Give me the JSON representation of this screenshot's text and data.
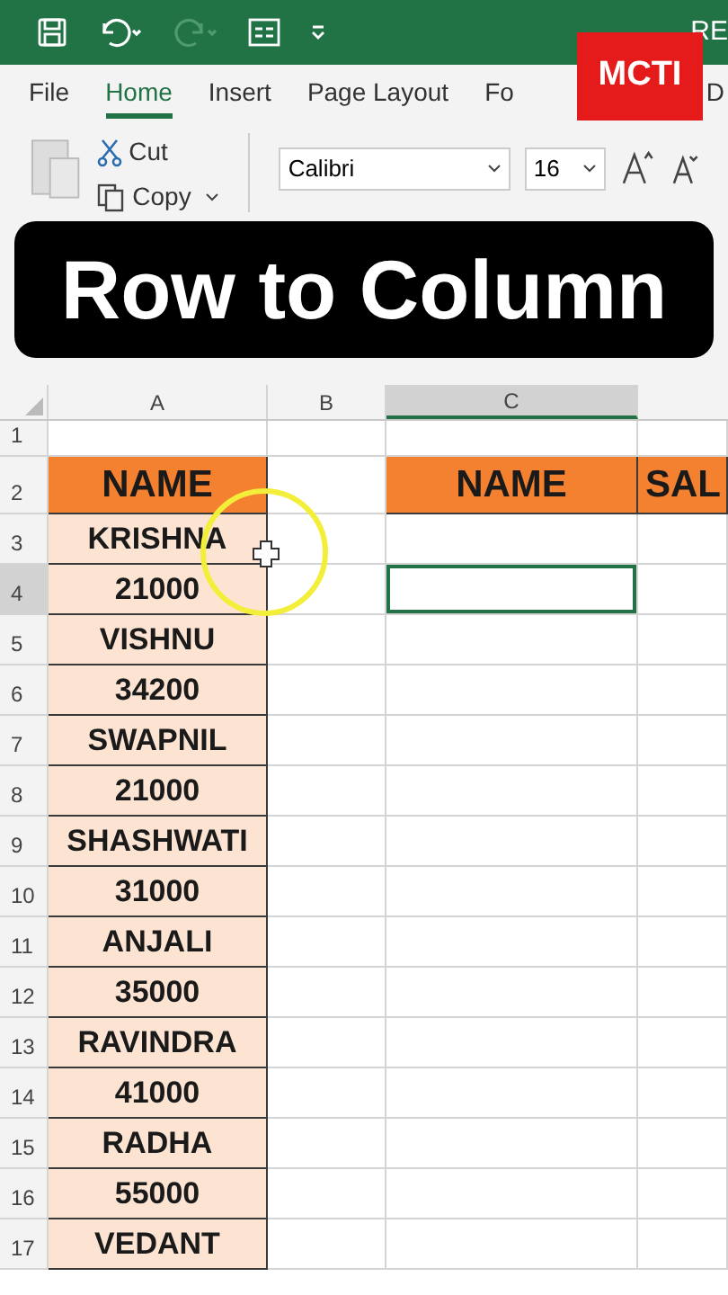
{
  "title_bar": {
    "title": "RE",
    "redo_disabled": true
  },
  "logo": {
    "text": "MCTI"
  },
  "tabs": [
    {
      "label": "File",
      "selected": false
    },
    {
      "label": "Home",
      "selected": true
    },
    {
      "label": "Insert",
      "selected": false
    },
    {
      "label": "Page Layout",
      "selected": false
    },
    {
      "label": "Fo",
      "selected": false
    },
    {
      "label": "D",
      "selected": false
    }
  ],
  "ribbon": {
    "cut": "Cut",
    "copy": "Copy",
    "font": "Calibri",
    "size": "16"
  },
  "caption": "Row to Column",
  "sheet": {
    "columns": [
      {
        "label": "A",
        "selected": false
      },
      {
        "label": "B",
        "selected": false
      },
      {
        "label": "C",
        "selected": true
      }
    ],
    "rows": [
      {
        "number": "1",
        "selected": false,
        "cells": [
          {
            "kind": "empty",
            "selected": false
          },
          {
            "kind": "empty",
            "selected": false
          },
          {
            "kind": "empty",
            "selected": false
          },
          {
            "kind": "empty",
            "selected": false
          }
        ]
      },
      {
        "number": "2",
        "selected": false,
        "cells": [
          {
            "kind": "header",
            "text": "NAME",
            "selected": false
          },
          {
            "kind": "empty",
            "selected": false
          },
          {
            "kind": "header",
            "text": "NAME",
            "selected": false
          },
          {
            "kind": "header",
            "text": "SAL",
            "selected": false
          }
        ]
      },
      {
        "number": "3",
        "selected": false,
        "cells": [
          {
            "kind": "data",
            "text": "KRISHNA",
            "selected": false
          },
          {
            "kind": "empty",
            "selected": false
          },
          {
            "kind": "empty",
            "selected": false
          },
          {
            "kind": "empty",
            "selected": false
          }
        ]
      },
      {
        "number": "4",
        "selected": true,
        "cells": [
          {
            "kind": "data",
            "text": "21000",
            "selected": false
          },
          {
            "kind": "empty",
            "selected": false
          },
          {
            "kind": "empty",
            "selected": true
          },
          {
            "kind": "empty",
            "selected": false
          }
        ]
      },
      {
        "number": "5",
        "selected": false,
        "cells": [
          {
            "kind": "data",
            "text": "VISHNU",
            "selected": false
          },
          {
            "kind": "empty",
            "selected": false
          },
          {
            "kind": "empty",
            "selected": false
          },
          {
            "kind": "empty",
            "selected": false
          }
        ]
      },
      {
        "number": "6",
        "selected": false,
        "cells": [
          {
            "kind": "data",
            "text": "34200",
            "selected": false
          },
          {
            "kind": "empty",
            "selected": false
          },
          {
            "kind": "empty",
            "selected": false
          },
          {
            "kind": "empty",
            "selected": false
          }
        ]
      },
      {
        "number": "7",
        "selected": false,
        "cells": [
          {
            "kind": "data",
            "text": "SWAPNIL",
            "selected": false
          },
          {
            "kind": "empty",
            "selected": false
          },
          {
            "kind": "empty",
            "selected": false
          },
          {
            "kind": "empty",
            "selected": false
          }
        ]
      },
      {
        "number": "8",
        "selected": false,
        "cells": [
          {
            "kind": "data",
            "text": "21000",
            "selected": false
          },
          {
            "kind": "empty",
            "selected": false
          },
          {
            "kind": "empty",
            "selected": false
          },
          {
            "kind": "empty",
            "selected": false
          }
        ]
      },
      {
        "number": "9",
        "selected": false,
        "cells": [
          {
            "kind": "data",
            "text": "SHASHWATI",
            "selected": false
          },
          {
            "kind": "empty",
            "selected": false
          },
          {
            "kind": "empty",
            "selected": false
          },
          {
            "kind": "empty",
            "selected": false
          }
        ]
      },
      {
        "number": "10",
        "selected": false,
        "cells": [
          {
            "kind": "data",
            "text": "31000",
            "selected": false
          },
          {
            "kind": "empty",
            "selected": false
          },
          {
            "kind": "empty",
            "selected": false
          },
          {
            "kind": "empty",
            "selected": false
          }
        ]
      },
      {
        "number": "11",
        "selected": false,
        "cells": [
          {
            "kind": "data",
            "text": "ANJALI",
            "selected": false
          },
          {
            "kind": "empty",
            "selected": false
          },
          {
            "kind": "empty",
            "selected": false
          },
          {
            "kind": "empty",
            "selected": false
          }
        ]
      },
      {
        "number": "12",
        "selected": false,
        "cells": [
          {
            "kind": "data",
            "text": "35000",
            "selected": false
          },
          {
            "kind": "empty",
            "selected": false
          },
          {
            "kind": "empty",
            "selected": false
          },
          {
            "kind": "empty",
            "selected": false
          }
        ]
      },
      {
        "number": "13",
        "selected": false,
        "cells": [
          {
            "kind": "data",
            "text": "RAVINDRA",
            "selected": false
          },
          {
            "kind": "empty",
            "selected": false
          },
          {
            "kind": "empty",
            "selected": false
          },
          {
            "kind": "empty",
            "selected": false
          }
        ]
      },
      {
        "number": "14",
        "selected": false,
        "cells": [
          {
            "kind": "data",
            "text": "41000",
            "selected": false
          },
          {
            "kind": "empty",
            "selected": false
          },
          {
            "kind": "empty",
            "selected": false
          },
          {
            "kind": "empty",
            "selected": false
          }
        ]
      },
      {
        "number": "15",
        "selected": false,
        "cells": [
          {
            "kind": "data",
            "text": "RADHA",
            "selected": false
          },
          {
            "kind": "empty",
            "selected": false
          },
          {
            "kind": "empty",
            "selected": false
          },
          {
            "kind": "empty",
            "selected": false
          }
        ]
      },
      {
        "number": "16",
        "selected": false,
        "cells": [
          {
            "kind": "data",
            "text": "55000",
            "selected": false
          },
          {
            "kind": "empty",
            "selected": false
          },
          {
            "kind": "empty",
            "selected": false
          },
          {
            "kind": "empty",
            "selected": false
          }
        ]
      },
      {
        "number": "17",
        "selected": false,
        "cells": [
          {
            "kind": "data",
            "text": "VEDANT",
            "selected": false
          },
          {
            "kind": "empty",
            "selected": false
          },
          {
            "kind": "empty",
            "selected": false
          },
          {
            "kind": "empty",
            "selected": false
          }
        ]
      }
    ]
  }
}
